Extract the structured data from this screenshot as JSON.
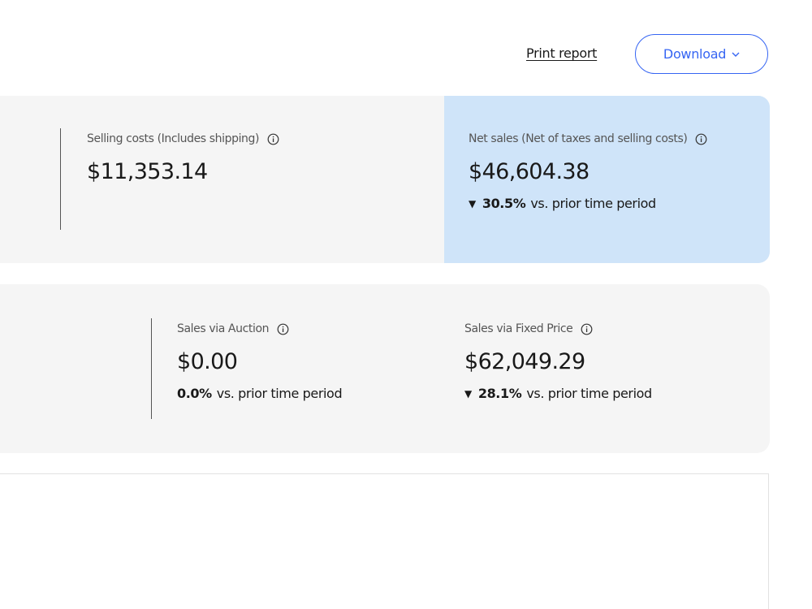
{
  "toolbar": {
    "print_label": "Print report",
    "download_label": "Download"
  },
  "summary": {
    "selling_costs": {
      "label": "Selling costs (Includes shipping)",
      "value": "$11,353.14"
    },
    "net_sales": {
      "label": "Net sales (Net of taxes and selling costs)",
      "value": "$46,604.38",
      "change_pct": "30.5%",
      "change_direction": "down",
      "change_suffix": "vs. prior time period"
    }
  },
  "channels": {
    "auction": {
      "label": "Sales via Auction",
      "value": "$0.00",
      "change_pct": "0.0%",
      "change_suffix": "vs. prior time period"
    },
    "fixed_price": {
      "label": "Sales via Fixed Price",
      "value": "$62,049.29",
      "change_pct": "28.1%",
      "change_direction": "down",
      "change_suffix": "vs. prior time period"
    }
  },
  "icons": {
    "arrow_down": "▼"
  },
  "colors": {
    "accent": "#3665f3",
    "panel_bg": "#f5f5f5",
    "highlight_bg": "#cfe4f9"
  }
}
